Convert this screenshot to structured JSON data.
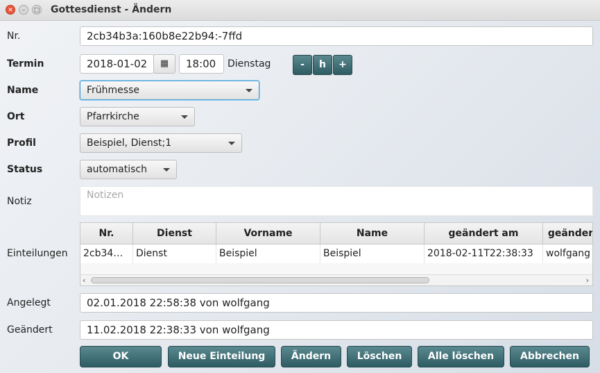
{
  "window": {
    "title": "Gottesdienst - Ändern",
    "close_glyph": "✕",
    "min_glyph": "–",
    "max_glyph": "□"
  },
  "form": {
    "nr_label": "Nr.",
    "nr_value": "2cb34b3a:160b8e22b94:-7ffd",
    "termin_label": "Termin",
    "date_value": "2018-01-02",
    "time_value": "18:00",
    "weekday": "Dienstag",
    "calendar_icon": "calendar-icon",
    "btn_minus": "-",
    "btn_h": "h",
    "btn_plus": "+",
    "name_label": "Name",
    "name_value": "Frühmesse",
    "ort_label": "Ort",
    "ort_value": "Pfarrkirche",
    "profil_label": "Profil",
    "profil_value": "Beispiel, Dienst;1",
    "status_label": "Status",
    "status_value": "automatisch",
    "notiz_label": "Notiz",
    "notiz_placeholder": "Notizen",
    "einteilungen_label": "Einteilungen",
    "angelegt_label": "Angelegt",
    "angelegt_value": "02.01.2018 22:58:38 von wolfgang",
    "geaendert_label": "Geändert",
    "geaendert_value": "11.02.2018 22:38:33 von wolfgang"
  },
  "table": {
    "columns": [
      "Nr.",
      "Dienst",
      "Vorname",
      "Name",
      "geändert am",
      "geänder"
    ],
    "rows": [
      [
        "2cb34…",
        "Dienst",
        "Beispiel",
        "Beispiel",
        "2018-02-11T22:38:33",
        "wolfgang"
      ]
    ],
    "scroll_left": "‹",
    "scroll_right": "›"
  },
  "buttons": {
    "ok": "OK",
    "neue_einteilung": "Neue Einteilung",
    "aendern": "Ändern",
    "loeschen": "Löschen",
    "alle_loeschen": "Alle löschen",
    "abbrechen": "Abbrechen"
  },
  "colors": {
    "accent_button": "#3f6d74",
    "focus": "#3c9bd4",
    "close_button": "#e8543a"
  }
}
